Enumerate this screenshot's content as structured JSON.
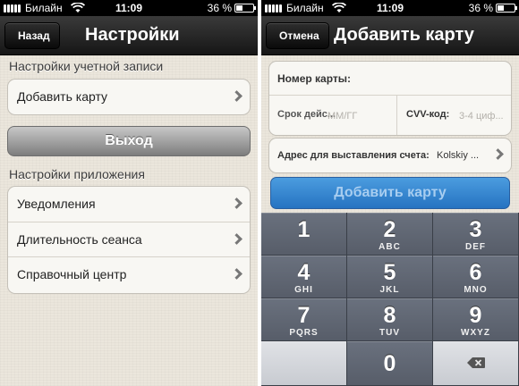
{
  "status_bar": {
    "carrier": "Билайн",
    "time": "11:09",
    "battery": "36 %",
    "battery_fraction": 0.36
  },
  "settings_screen": {
    "back_button": "Назад",
    "title": "Настройки",
    "account_section_header": "Настройки учетной записи",
    "add_card_row": "Добавить карту",
    "logout_button": "Выход",
    "app_section_header": "Настройки приложения",
    "app_rows": [
      {
        "label": "Уведомления"
      },
      {
        "label": "Длительность сеанса"
      },
      {
        "label": "Справочный центр"
      }
    ]
  },
  "add_card_screen": {
    "cancel_button": "Отмена",
    "title": "Добавить карту",
    "card_number_label": "Номер карты:",
    "expiry_label": "Срок дейс...",
    "expiry_placeholder": "ММ/ГГ",
    "cvv_label": "CVV-код:",
    "cvv_placeholder": "3-4 циф...",
    "billing_address_label": "Адрес для выставления счета:",
    "billing_address_value": "Kolskiy ...",
    "submit_button": "Добавить карту"
  },
  "keypad": {
    "keys": [
      {
        "digit": "1",
        "letters": ""
      },
      {
        "digit": "2",
        "letters": "ABC"
      },
      {
        "digit": "3",
        "letters": "DEF"
      },
      {
        "digit": "4",
        "letters": "GHI"
      },
      {
        "digit": "5",
        "letters": "JKL"
      },
      {
        "digit": "6",
        "letters": "MNO"
      },
      {
        "digit": "7",
        "letters": "PQRS"
      },
      {
        "digit": "8",
        "letters": "TUV"
      },
      {
        "digit": "9",
        "letters": "WXYZ"
      },
      {
        "digit": "0",
        "letters": ""
      }
    ],
    "delete_icon": "backspace-icon"
  },
  "icons": {
    "signal": "signal-strength-icon",
    "wifi": "wifi-icon",
    "battery": "battery-icon",
    "chevron": "chevron-right-icon"
  },
  "colors": {
    "background": "#ebe6dc",
    "nav_bar": "#1f1f1f",
    "primary_button": "#2f7fcc",
    "logout_button": "#9e9e9e",
    "keypad": "#5e6470"
  }
}
